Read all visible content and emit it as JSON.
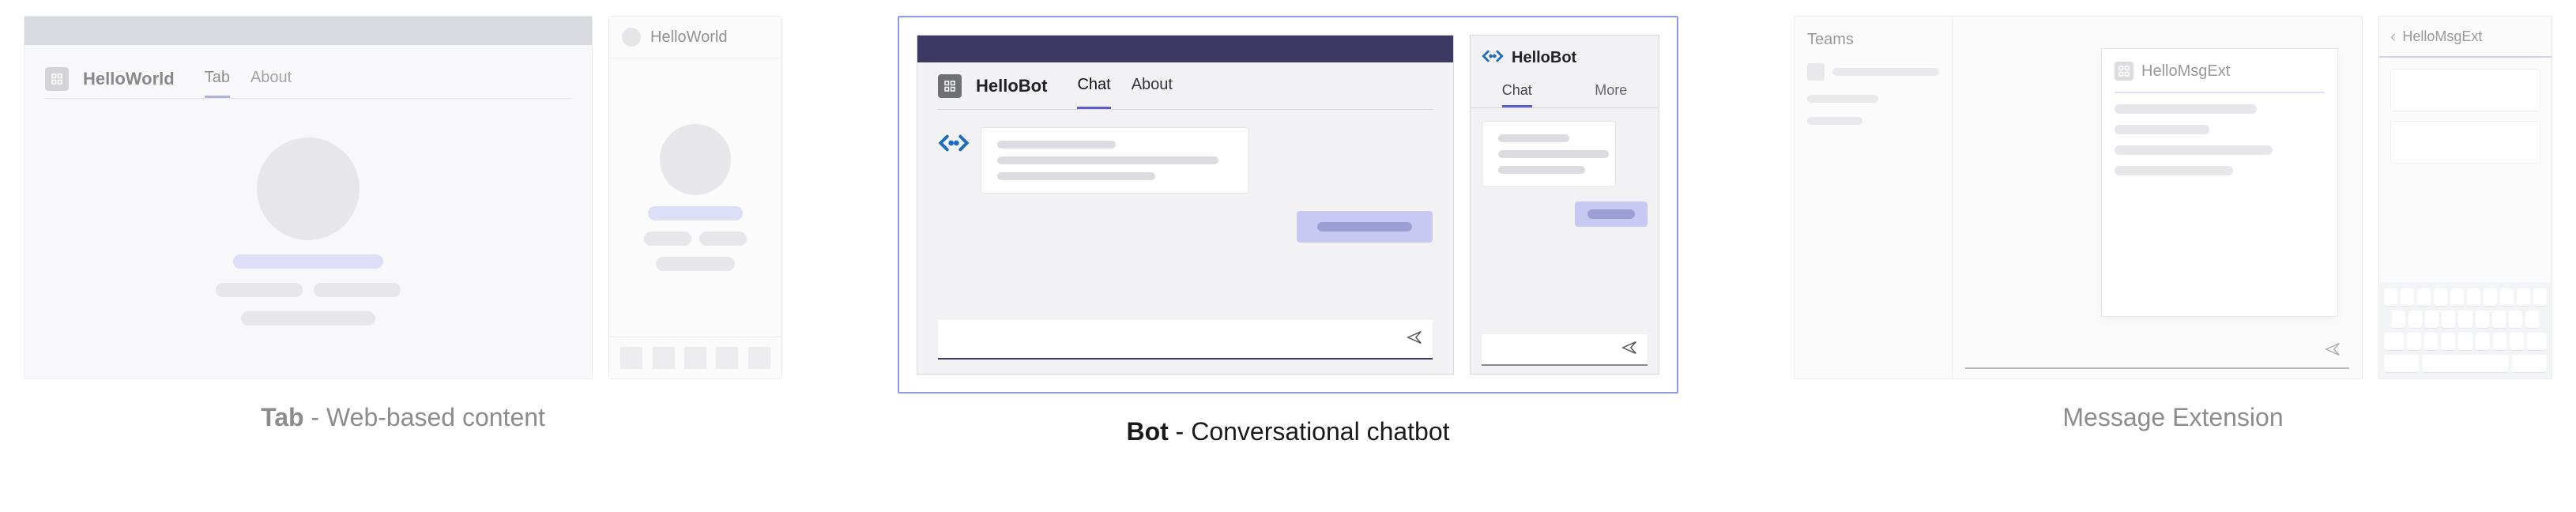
{
  "tab": {
    "app_name": "HelloWorld",
    "tabs": {
      "t1": "Tab",
      "t2": "About"
    },
    "mobile_title": "HelloWorld",
    "caption_bold": "Tab",
    "caption_rest": " - Web-based content"
  },
  "bot": {
    "app_name": "HelloBot",
    "tabs": {
      "t1": "Chat",
      "t2": "About"
    },
    "mobile_name": "HelloBot",
    "mobile_tabs": {
      "t1": "Chat",
      "t2": "More"
    },
    "caption_bold": "Bot",
    "caption_rest": " - Conversational chatbot"
  },
  "ext": {
    "sidebar_title": "Teams",
    "popup_title": "HelloMsgExt",
    "mobile_title": "HelloMsgExt",
    "caption": "Message Extension"
  }
}
